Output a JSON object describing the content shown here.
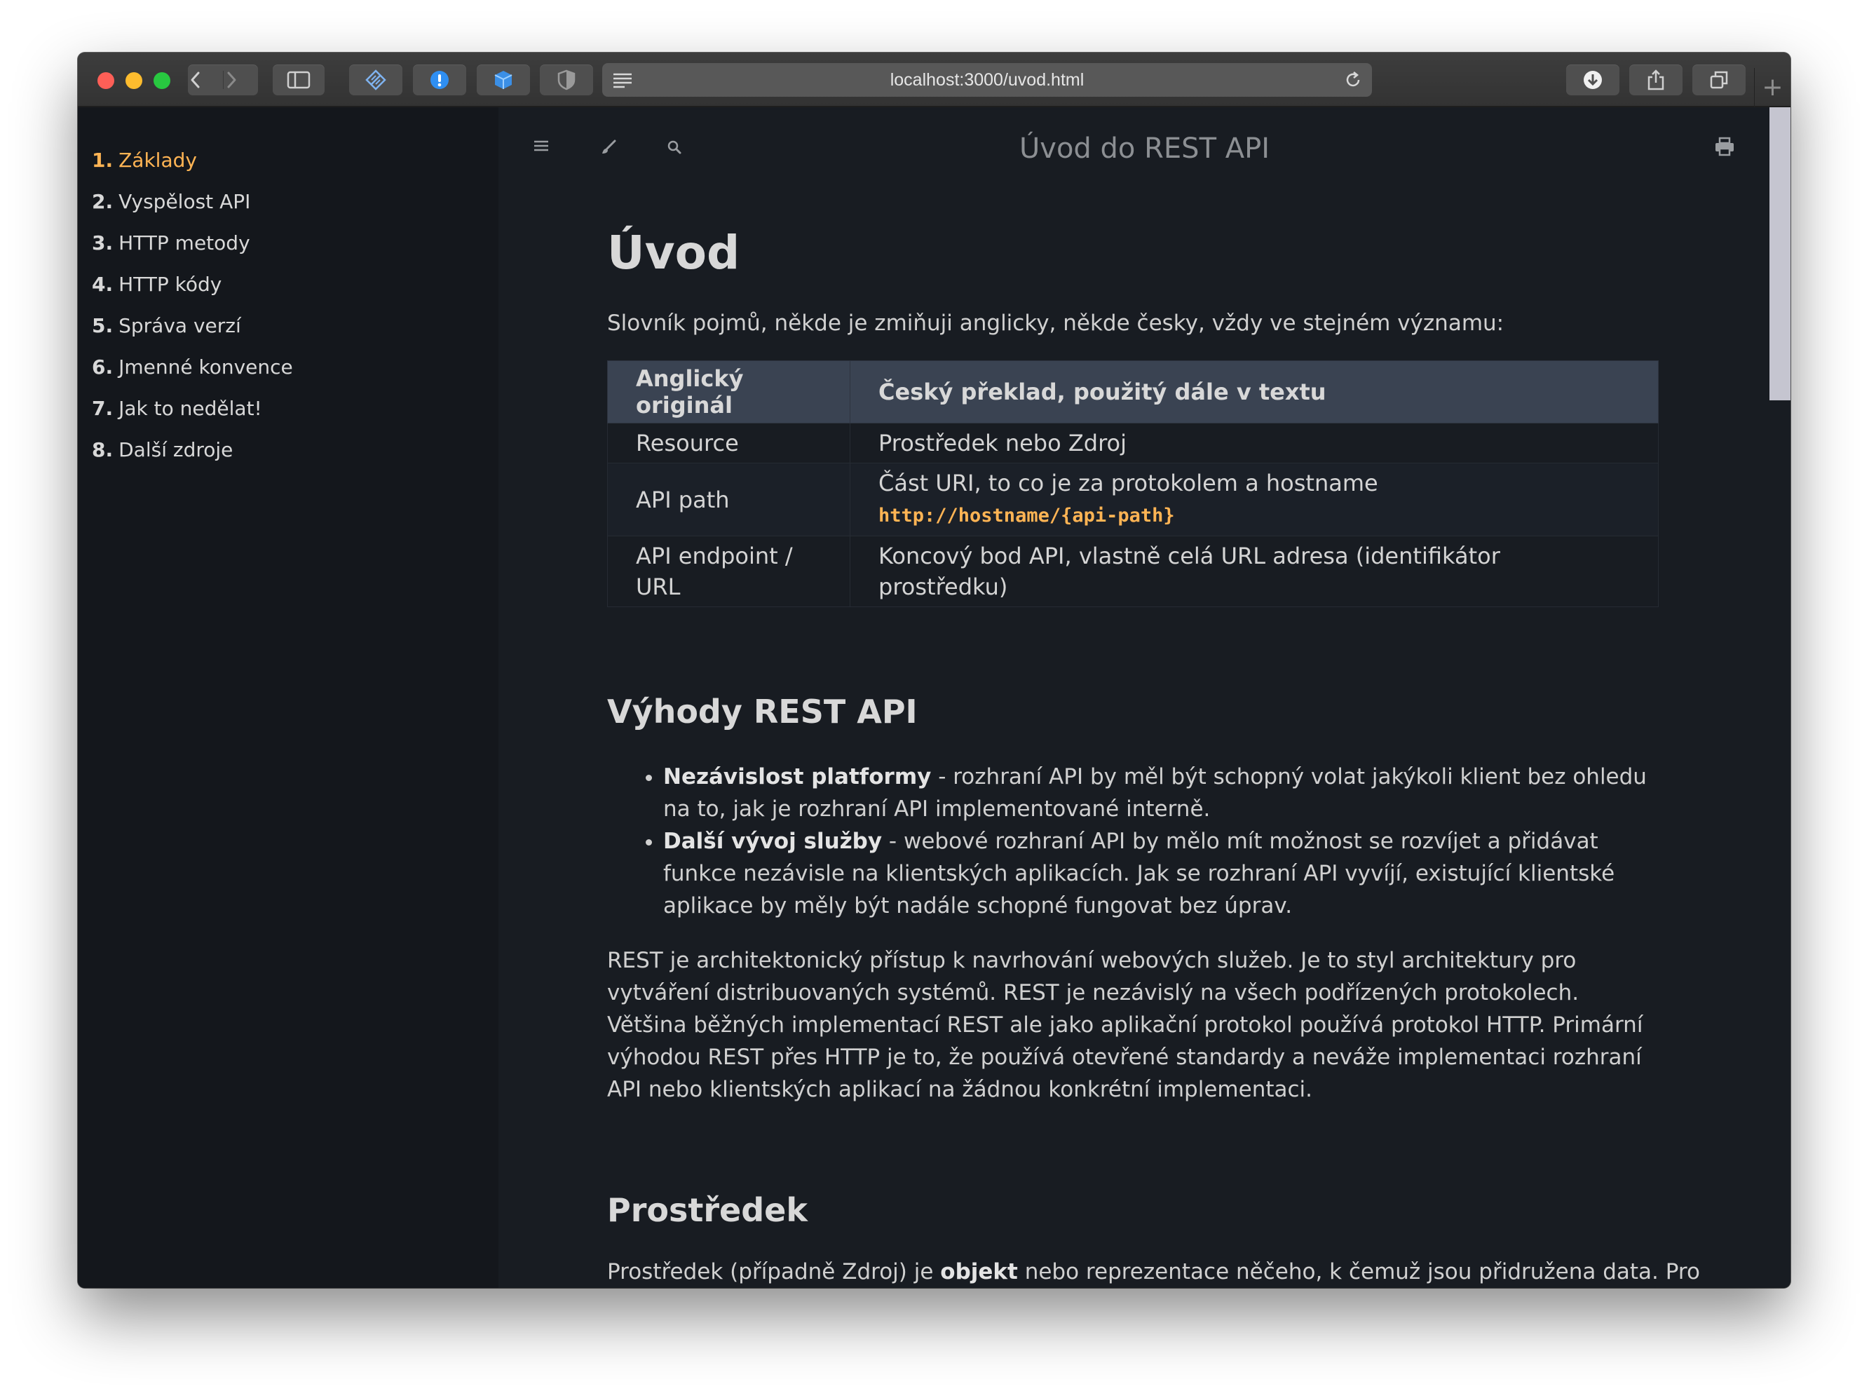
{
  "browser": {
    "url": "localhost:3000/uvod.html"
  },
  "sidebar": {
    "items": [
      {
        "num": "1.",
        "label": "Základy",
        "active": true
      },
      {
        "num": "2.",
        "label": "Vyspělost API"
      },
      {
        "num": "3.",
        "label": "HTTP metody"
      },
      {
        "num": "4.",
        "label": "HTTP kódy"
      },
      {
        "num": "5.",
        "label": "Správa verzí"
      },
      {
        "num": "6.",
        "label": "Jmenné konvence"
      },
      {
        "num": "7.",
        "label": "Jak to nedělat!"
      },
      {
        "num": "8.",
        "label": "Další zdroje"
      }
    ]
  },
  "header": {
    "book_title": "Úvod do REST API"
  },
  "content": {
    "h1": "Úvod",
    "intro": "Slovník pojmů, někde je zmiňuji anglicky, někde česky, vždy ve stejném významu:",
    "table": {
      "headers": [
        "Anglický originál",
        "Český překlad, použitý dále v textu"
      ],
      "rows": [
        {
          "en": "Resource",
          "cz": "Prostředek nebo Zdroj",
          "code": ""
        },
        {
          "en": "API path",
          "cz": "Část URI, to co je za protokolem a hostname",
          "code": "http://hostname/{api-path}"
        },
        {
          "en": "API endpoint / URL",
          "cz": "Koncový bod API, vlastně celá URL adresa (identifikátor prostředku)",
          "code": ""
        }
      ]
    },
    "section_advantages": {
      "heading": "Výhody REST API",
      "bullets": [
        {
          "term": "Nezávislost platformy",
          "text": " - rozhraní API by měl být schopný volat jakýkoli klient bez ohledu na to, jak je rozhraní API implementované interně."
        },
        {
          "term": "Další vývoj služby",
          "text": " - webové rozhraní API by mělo mít možnost se rozvíjet a přidávat funkce nezávisle na klientských aplikacích. Jak se rozhraní API vyvíjí, existující klientské aplikace by měly být nadále schopné fungovat bez úprav."
        }
      ],
      "paragraph": "REST je architektonický přístup k navrhování webových služeb. Je to styl architektury pro vytváření distribuovaných systémů. REST je nezávislý na všech podřízených protokolech. Většina běžných implementací REST ale jako aplikační protokol používá protokol HTTP. Primární výhodou REST přes HTTP je to, že používá otevřené standardy a neváže implementaci rozhraní API nebo klientských aplikací na žádnou konkrétní implementaci."
    },
    "section_resource": {
      "heading": "Prostředek",
      "p_start": "Prostředek (případně Zdroj) je ",
      "p_bold": "objekt",
      "p_end": " nebo reprezentace něčeho, k čemuž jsou přidružena data. Pro"
    }
  },
  "colors": {
    "accent": "#ffb454",
    "sidebar_bg": "#14171c",
    "content_bg": "#181c22",
    "table_header_bg": "#3a4352"
  },
  "icons": [
    "back-icon",
    "forward-icon",
    "sidebar-toggle-icon",
    "extension-icon",
    "info-icon",
    "box-icon",
    "shield-icon",
    "reader-icon",
    "reload-icon",
    "download-icon",
    "share-icon",
    "tabs-icon",
    "new-tab-icon",
    "menu-icon",
    "brush-icon",
    "search-icon",
    "print-icon"
  ]
}
